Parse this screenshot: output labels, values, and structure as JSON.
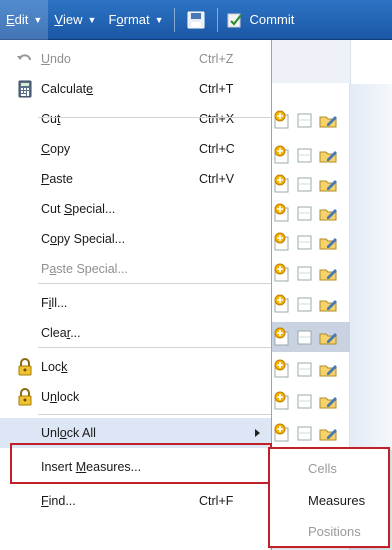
{
  "toolbar": {
    "menus": [
      {
        "label": "Edit",
        "underline": "E",
        "rest": "dit"
      },
      {
        "label": "View",
        "underline": "V",
        "rest": "iew"
      },
      {
        "label": "Format",
        "pre": "F",
        "underline": "o",
        "rest": "rmat"
      }
    ],
    "commit_label": "Commit",
    "colors": {
      "bar_top": "#2d74c4",
      "bar_bottom": "#1b57a6"
    }
  },
  "edit_menu": {
    "items": [
      {
        "pre": "",
        "u": "U",
        "post": "ndo",
        "shortcut": "Ctrl+Z",
        "disabled": true,
        "icon": "undo-icon"
      },
      {
        "pre": "Calculat",
        "u": "e",
        "post": "",
        "shortcut": "Ctrl+T",
        "disabled": false,
        "icon": "calculator-icon"
      },
      {
        "pre": "Cu",
        "u": "t",
        "post": "",
        "shortcut": "Ctrl+X",
        "disabled": false
      },
      {
        "pre": "",
        "u": "C",
        "post": "opy",
        "shortcut": "Ctrl+C",
        "disabled": false
      },
      {
        "pre": "",
        "u": "P",
        "post": "aste",
        "shortcut": "Ctrl+V",
        "disabled": false
      },
      {
        "pre": "Cut ",
        "u": "S",
        "post": "pecial...",
        "shortcut": "",
        "disabled": false
      },
      {
        "pre": "C",
        "u": "o",
        "post": "py Special...",
        "shortcut": "",
        "disabled": false
      },
      {
        "pre": "P",
        "u": "a",
        "post": "ste Special...",
        "shortcut": "",
        "disabled": true
      },
      {
        "pre": "F",
        "u": "i",
        "post": "ll...",
        "shortcut": "",
        "disabled": false
      },
      {
        "pre": "Clea",
        "u": "r",
        "post": "...",
        "shortcut": "",
        "disabled": false
      },
      {
        "pre": "Loc",
        "u": "k",
        "post": "",
        "shortcut": "",
        "disabled": false,
        "icon": "lock-icon"
      },
      {
        "pre": "U",
        "u": "n",
        "post": "lock",
        "shortcut": "",
        "disabled": false,
        "icon": "lock-icon"
      },
      {
        "pre": "Unl",
        "u": "o",
        "post": "ck All",
        "shortcut": "",
        "disabled": false,
        "submenu": true
      },
      {
        "pre": "Insert ",
        "u": "M",
        "post": "easures...",
        "shortcut": "",
        "disabled": false
      },
      {
        "pre": "",
        "u": "F",
        "post": "ind...",
        "shortcut": "Ctrl+F",
        "disabled": false
      }
    ]
  },
  "submenu": {
    "items": [
      {
        "label": "Cells",
        "disabled": true
      },
      {
        "label": "Measures",
        "disabled": false
      },
      {
        "label": "Positions",
        "disabled": true
      }
    ]
  },
  "highlight_color": "#c0202a"
}
